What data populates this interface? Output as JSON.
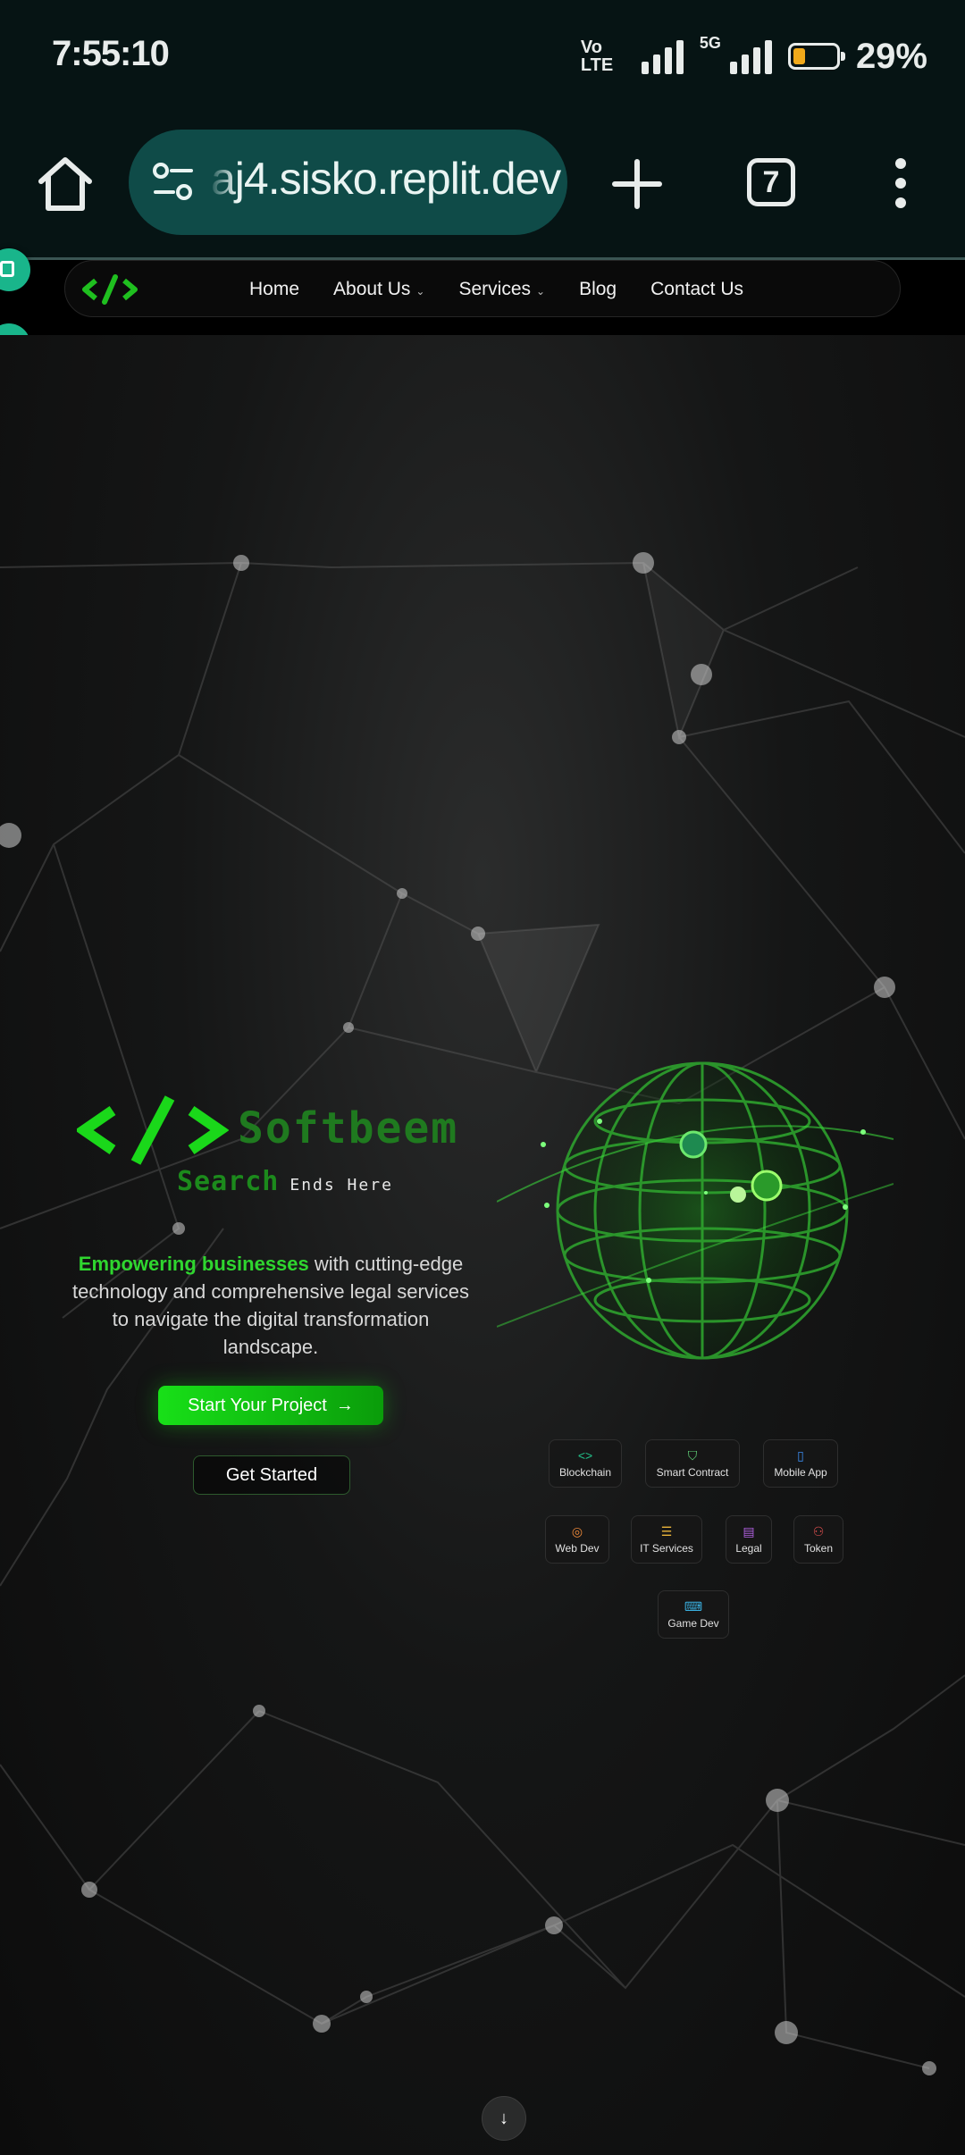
{
  "status_bar": {
    "time": "7:55:10",
    "volte_top": "Vo",
    "volte_bottom": "LTE",
    "network_type": "5G",
    "battery_percent_text": "29%",
    "battery_level": 0.29,
    "battery_color": "#f1a91a"
  },
  "browser": {
    "url": "aj4.sisko.replit.dev",
    "tab_count": "7",
    "icons": [
      "home-icon",
      "site-settings-icon",
      "new-tab-icon",
      "tab-switcher-icon",
      "more-menu-icon"
    ]
  },
  "site_nav": {
    "logo_text": "</>",
    "links": [
      "Home",
      "About Us",
      "Services",
      "Blog",
      "Contact Us"
    ],
    "has_dropdown": [
      false,
      true,
      true,
      false,
      false
    ]
  },
  "hero": {
    "brand_name": "Softbeem",
    "tagline_strong": "Search",
    "tagline_rest": "Ends Here",
    "description_highlight": "Empowering businesses",
    "description_rest": " with cutting-edge technology and comprehensive legal services to navigate the digital transformation landscape.",
    "primary_cta": "Start Your Project",
    "secondary_cta": "Get Started",
    "accent_color": "#22c322"
  },
  "services": [
    {
      "label": "Blockchain",
      "icon": "code-icon",
      "color": "#22c38b"
    },
    {
      "label": "Smart Contract",
      "icon": "shield-icon",
      "color": "#62d67a"
    },
    {
      "label": "Mobile App",
      "icon": "smartphone-icon",
      "color": "#3b8cf0"
    },
    {
      "label": "Web Dev",
      "icon": "globe-icon",
      "color": "#f08a3a"
    },
    {
      "label": "IT Services",
      "icon": "server-icon",
      "color": "#e9b43a"
    },
    {
      "label": "Legal",
      "icon": "document-icon",
      "color": "#b060e0"
    },
    {
      "label": "Token",
      "icon": "coins-icon",
      "color": "#e05050"
    },
    {
      "label": "Game Dev",
      "icon": "gamepad-icon",
      "color": "#3ab0e0"
    }
  ]
}
